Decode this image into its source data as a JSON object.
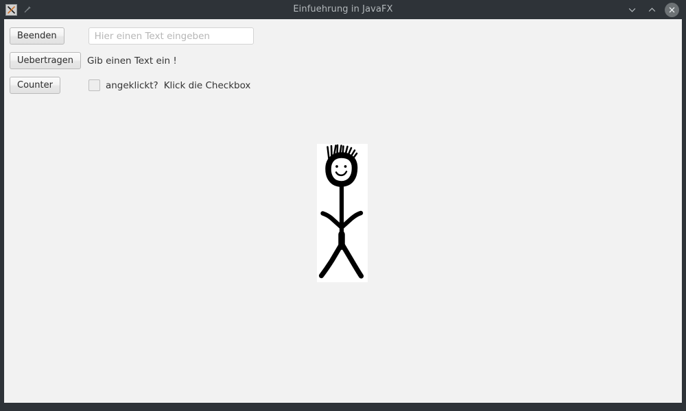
{
  "window": {
    "title": "Einfuehrung in JavaFX",
    "app_icon_glyph": "X",
    "app_icon_name": "x-window-app-icon",
    "pin_icon_name": "pin-icon",
    "background_color": "#f2f2f2",
    "titlebar_color": "#2e3338",
    "title_color": "#b3b8bb"
  },
  "titlebar_controls": {
    "minimize_label": "⌄",
    "maximize_label": "⌃",
    "close_label": "✕"
  },
  "controls": {
    "quit_button": "Beenden",
    "transfer_button": "Uebertragen",
    "counter_button": "Counter",
    "text_input_value": "",
    "text_input_placeholder": "Hier einen Text eingeben",
    "transfer_label": "Gib einen Text ein !",
    "checkbox_checked": false,
    "checkbox_state_label": "angeklickt?",
    "checkbox_hint_label": "Klick die Checkbox"
  },
  "image": {
    "alt": "stick-figure-drawing",
    "background_color": "#ffffff",
    "ink_color": "#000000"
  }
}
